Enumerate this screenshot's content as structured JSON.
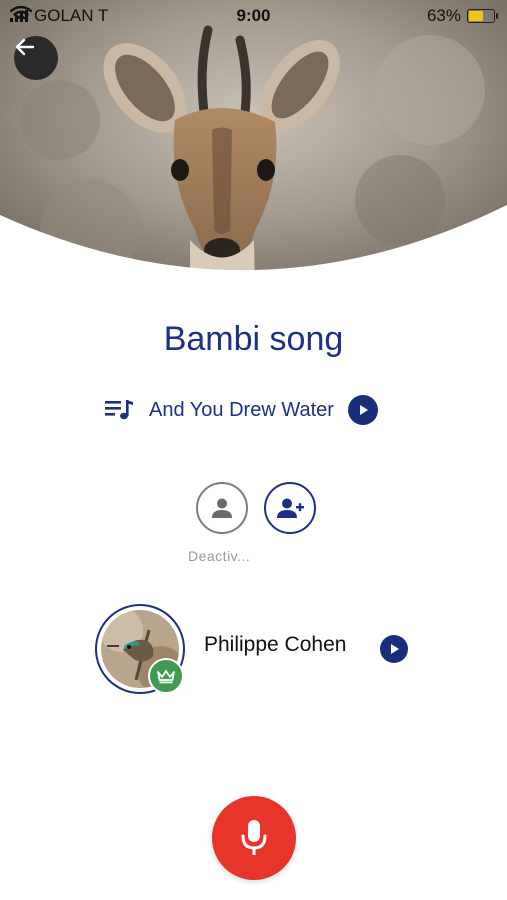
{
  "status_bar": {
    "carrier": "GOLAN T",
    "time": "9:00",
    "battery_percent": "63%",
    "battery_level": 0.63
  },
  "header": {
    "back_icon": "arrow-left-icon",
    "hero_image": "gazelle-photo"
  },
  "song": {
    "title": "Bambi song",
    "track_icon": "playlist-music-icon",
    "track_name": "And You Drew Water",
    "play_icon": "play-icon"
  },
  "participants": {
    "deactivated_icon": "person-icon",
    "add_icon": "add-person-icon",
    "deactivated_label": "Deactiv..."
  },
  "member": {
    "name": "Philippe Cohen",
    "badge_icon": "crown-icon",
    "avatar": "bird-photo",
    "play_icon": "play-icon"
  },
  "record": {
    "icon": "microphone-icon"
  },
  "colors": {
    "primary": "#1e2f8a",
    "record": "#e8352b",
    "badge": "#3f9a52"
  }
}
